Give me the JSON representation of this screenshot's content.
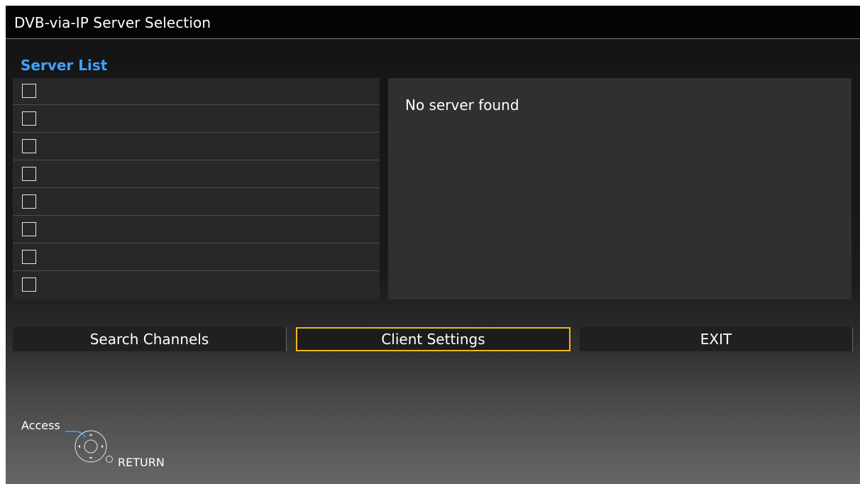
{
  "title": "DVB-via-IP Server Selection",
  "server_list": {
    "label": "Server List",
    "rows": [
      "",
      "",
      "",
      "",
      "",
      "",
      "",
      ""
    ]
  },
  "info": {
    "message": "No server found"
  },
  "buttons": {
    "search": "Search Channels",
    "client_settings": "Client Settings",
    "exit": "EXIT"
  },
  "hints": {
    "access": "Access",
    "return": "RETURN"
  },
  "colors": {
    "accent": "#3ea3ff",
    "focus": "#f3b619"
  }
}
